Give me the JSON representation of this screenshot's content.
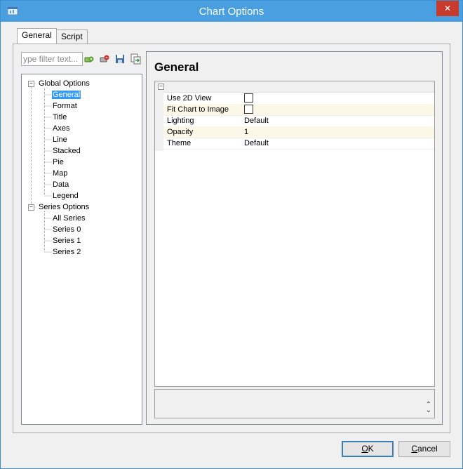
{
  "window": {
    "title": "Chart Options",
    "close_label": "✕"
  },
  "tabs": [
    {
      "label": "General",
      "active": true
    },
    {
      "label": "Script",
      "active": false
    }
  ],
  "filter": {
    "placeholder": "ype filter text..."
  },
  "toolbar_icons": [
    "add-icon",
    "remove-icon",
    "save-icon",
    "import-icon"
  ],
  "tree": {
    "global": {
      "label": "Global Options",
      "expander": "−",
      "items": [
        "General",
        "Format",
        "Title",
        "Axes",
        "Line",
        "Stacked",
        "Pie",
        "Map",
        "Data",
        "Legend"
      ]
    },
    "series": {
      "label": "Series Options",
      "expander": "−",
      "items": [
        "All Series",
        "Series 0",
        "Series 1",
        "Series 2"
      ]
    }
  },
  "panel": {
    "heading": "General",
    "category_expander": "−",
    "properties": [
      {
        "name": "Use 2D View",
        "type": "checkbox",
        "value": ""
      },
      {
        "name": "Fit Chart to Image",
        "type": "checkbox",
        "value": ""
      },
      {
        "name": "Lighting",
        "type": "text",
        "value": "Default"
      },
      {
        "name": "Opacity",
        "type": "text",
        "value": "1"
      },
      {
        "name": "Theme",
        "type": "text",
        "value": "Default"
      }
    ]
  },
  "buttons": {
    "ok_prefix": "",
    "ok_underline": "O",
    "ok_rest": "K",
    "cancel_underline": "C",
    "cancel_rest": "ancel"
  },
  "desc_scroll": {
    "up": "⌃",
    "down": "⌄"
  },
  "colors": {
    "titlebar": "#4a9fe0",
    "close": "#c83b2c",
    "selection": "#3399ff"
  }
}
